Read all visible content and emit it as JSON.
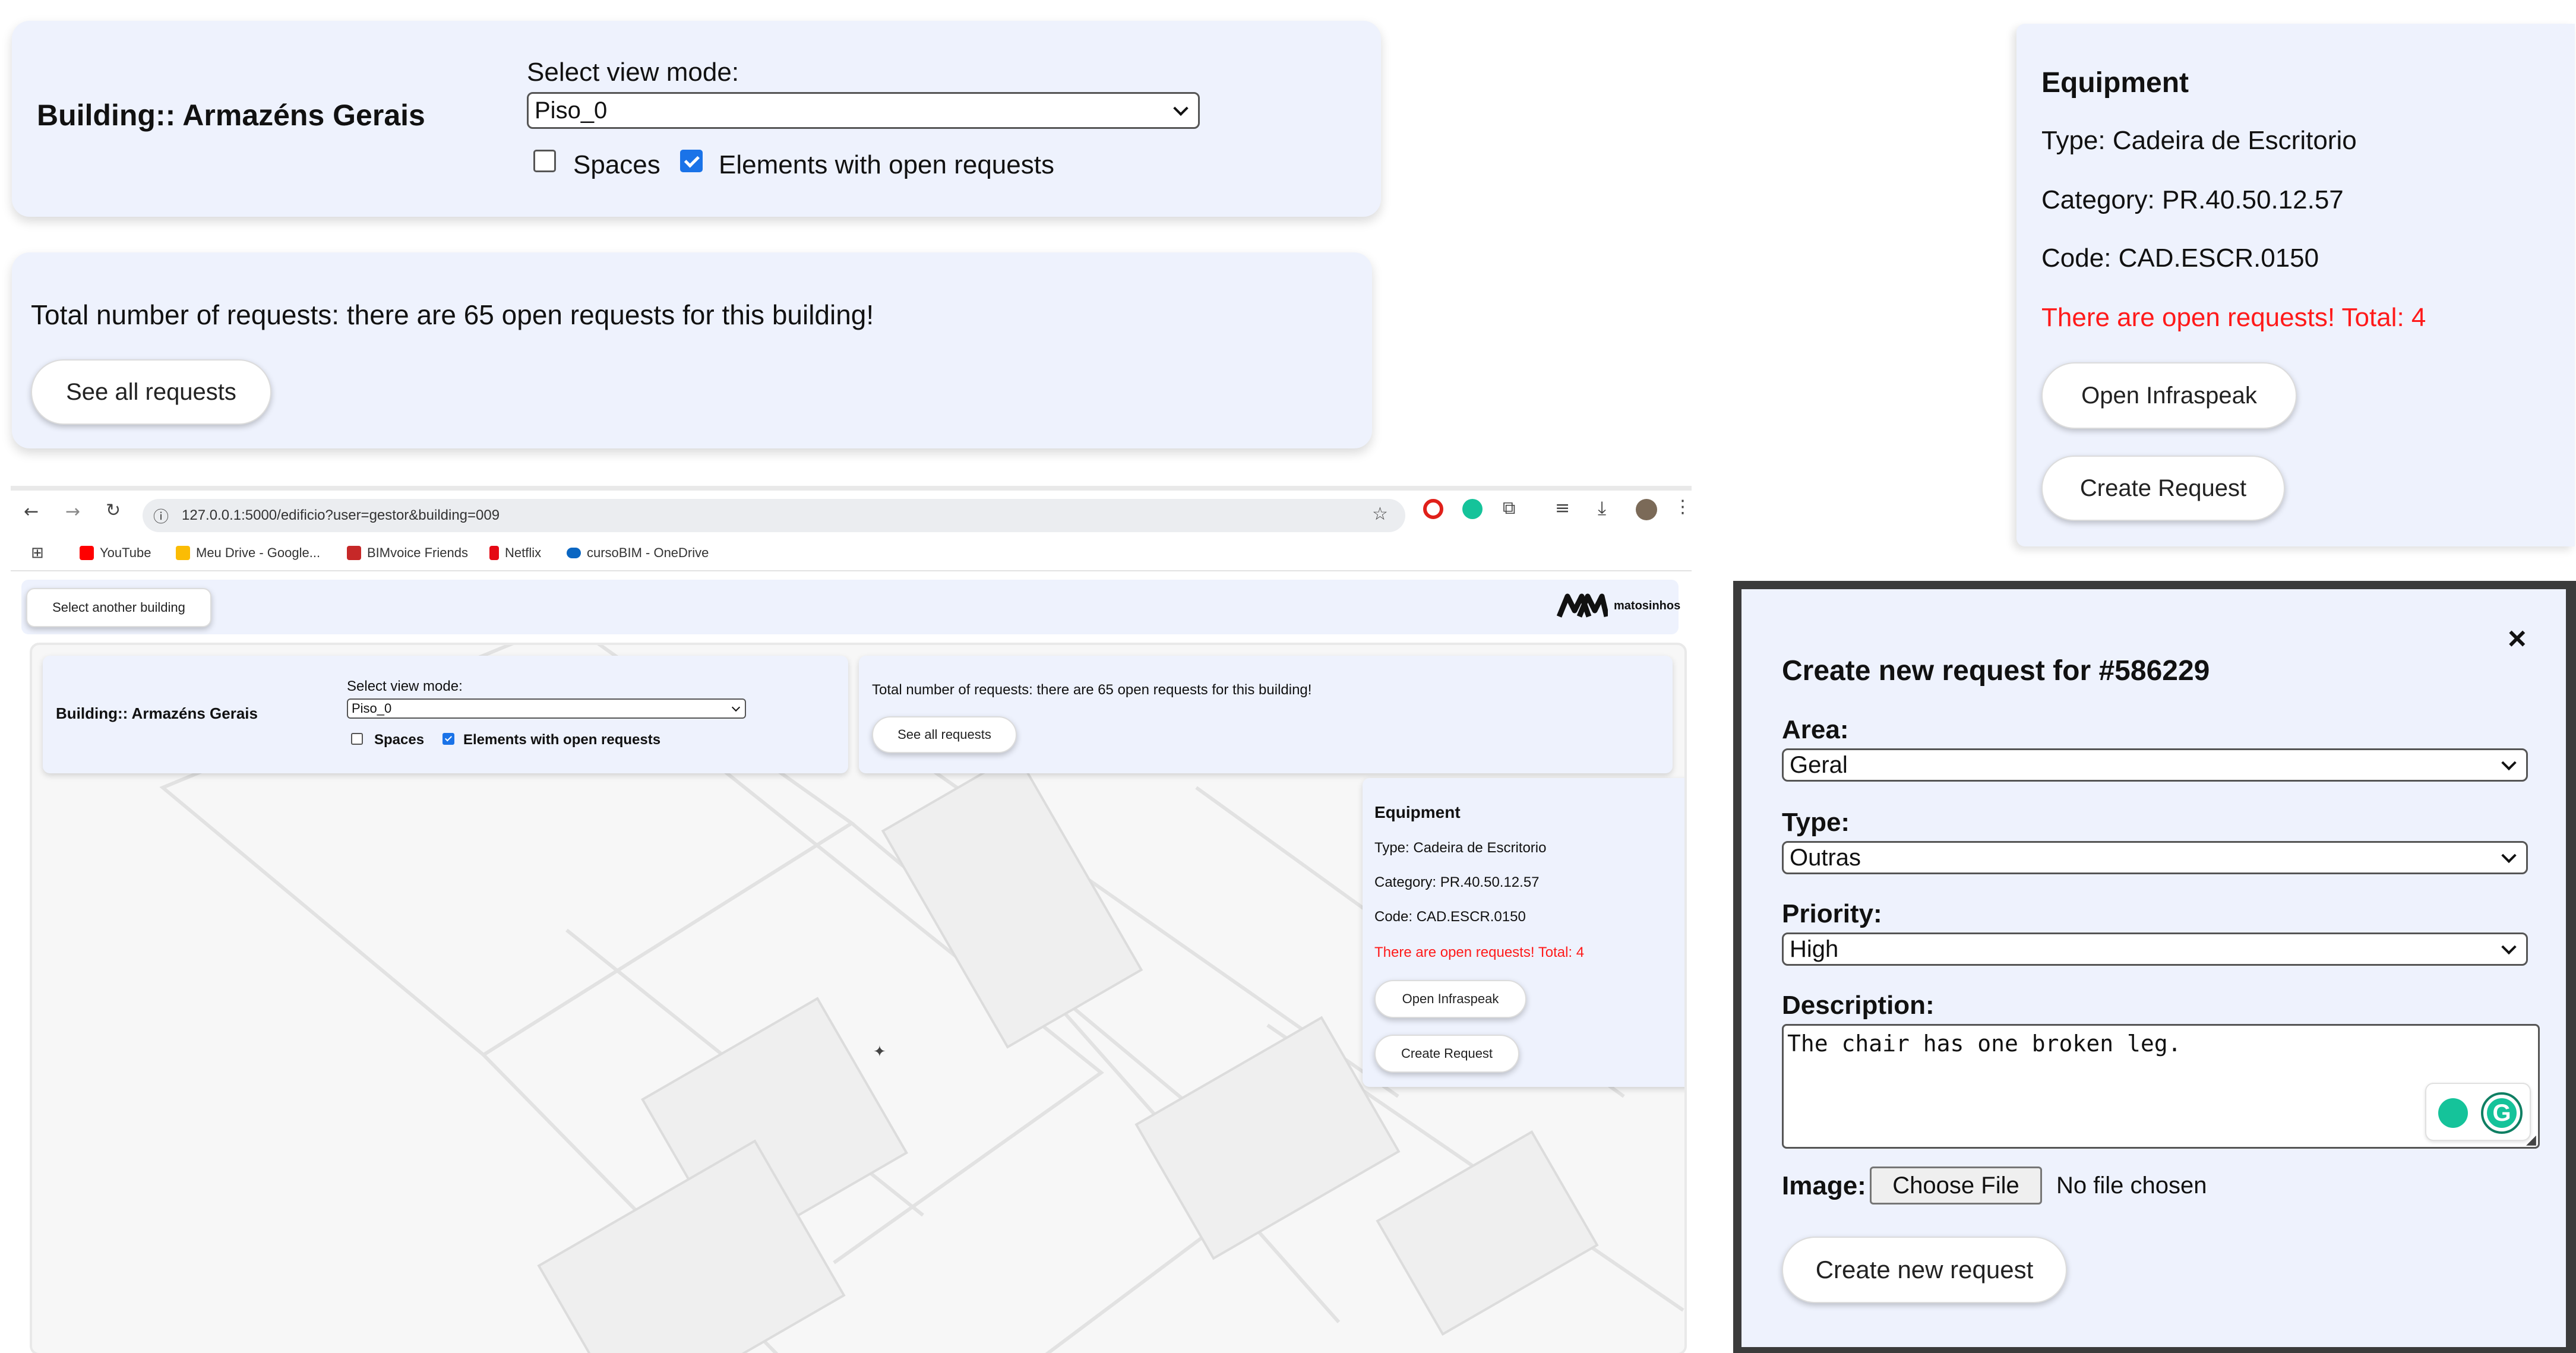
{
  "top_panel": {
    "building_title": "Building:: Armazéns Gerais",
    "view_mode_label": "Select view mode:",
    "view_mode_value": "Piso_0",
    "spaces_label": "Spaces",
    "spaces_checked": false,
    "open_requests_label": "Elements with open requests",
    "open_requests_checked": true
  },
  "requests_panel": {
    "summary": "Total number of requests: there are 65 open requests for this building!",
    "see_all_button": "See all requests"
  },
  "equipment": {
    "heading": "Equipment",
    "type": "Type: Cadeira de Escritorio",
    "category": "Category: PR.40.50.12.57",
    "code": "Code: CAD.ESCR.0150",
    "open_requests_warning": "There are open requests! Total: 4",
    "open_infraspeak_button": "Open Infraspeak",
    "create_request_button": "Create Request"
  },
  "browser": {
    "url": "127.0.0.1:5000/edificio?user=gestor&building=009",
    "bookmarks": [
      {
        "label": "YouTube",
        "color": "#ff0000"
      },
      {
        "label": "Meu Drive - Google...",
        "color": "#fbbc04"
      },
      {
        "label": "BIMvoice Friends",
        "color": "#c62828"
      },
      {
        "label": "Netflix",
        "color": "#e50914"
      },
      {
        "label": "cursoBIM - OneDrive",
        "color": "#0a66c2"
      }
    ],
    "select_building_button": "Select another building",
    "logo_text": "matosinhos"
  },
  "modal": {
    "title": "Create new request for #586229",
    "close_symbol": "×",
    "area_label": "Area:",
    "area_value": "Geral",
    "type_label": "Type:",
    "type_value": "Outras",
    "priority_label": "Priority:",
    "priority_value": "High",
    "description_label": "Description:",
    "description_value": "The chair has one broken leg.",
    "image_label": "Image:",
    "choose_file_button": "Choose File",
    "no_file_text": "No file chosen",
    "submit_button": "Create new request"
  },
  "colors": {
    "panel_bg": "#eef2fd",
    "warning_red": "#ff1a1a",
    "checkbox_blue": "#1a73e8"
  }
}
